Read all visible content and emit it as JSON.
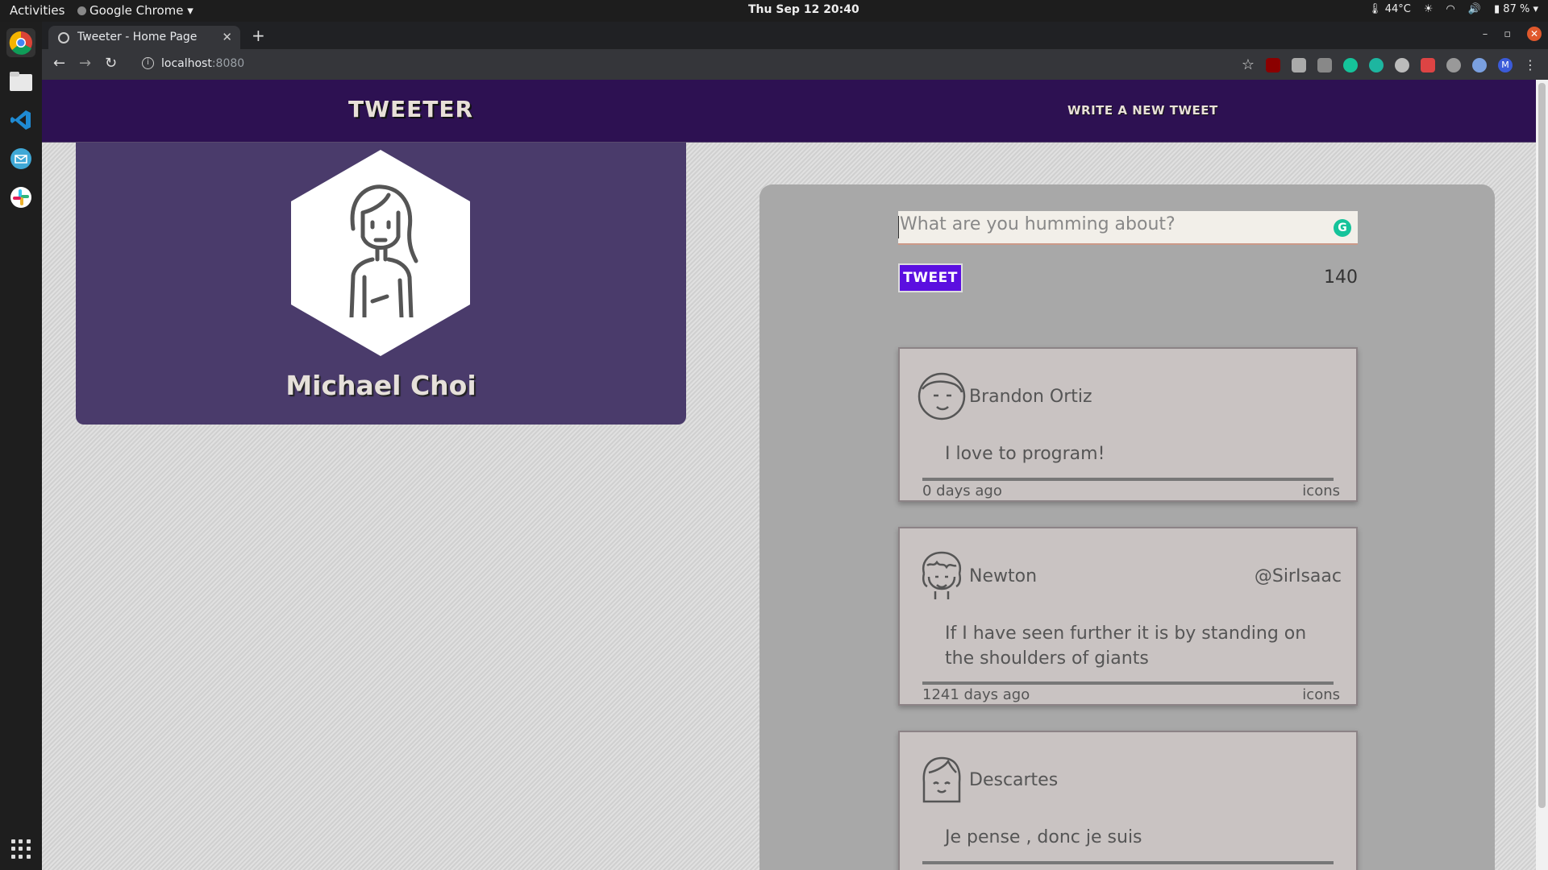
{
  "os": {
    "activities": "Activities",
    "app_menu": "Google Chrome",
    "clock": "Thu Sep 12  20:40",
    "temperature": "44°C",
    "battery": "87 %"
  },
  "browser": {
    "tab_title": "Tweeter - Home Page",
    "url_host": "localhost",
    "url_port": ":8080",
    "profile_initial": "M"
  },
  "nav": {
    "brand": "TWEETER",
    "compose_link": "WRITE A NEW TWEET"
  },
  "profile": {
    "name": "Michael Choi"
  },
  "composer": {
    "placeholder": "What are you humming about?",
    "button_label": "TWEET",
    "char_count": "140"
  },
  "tweets": [
    {
      "name": "Brandon Ortiz",
      "handle": "",
      "content": "I love to program!",
      "ago": "0 days ago",
      "icons": "icons"
    },
    {
      "name": "Newton",
      "handle": "@SirIsaac",
      "content": "If I have seen further it is by standing on the shoulders of giants",
      "ago": "1241 days ago",
      "icons": "icons"
    },
    {
      "name": "Descartes",
      "handle": "",
      "content": "Je pense , donc je suis",
      "ago": "",
      "icons": ""
    }
  ],
  "colors": {
    "nav_bg": "#2d1152",
    "profile_bg": "#4a3b6b",
    "tweet_button": "#5b0fe0",
    "feed_bg": "#a8a8a8",
    "card_bg": "#c9c3c2"
  }
}
